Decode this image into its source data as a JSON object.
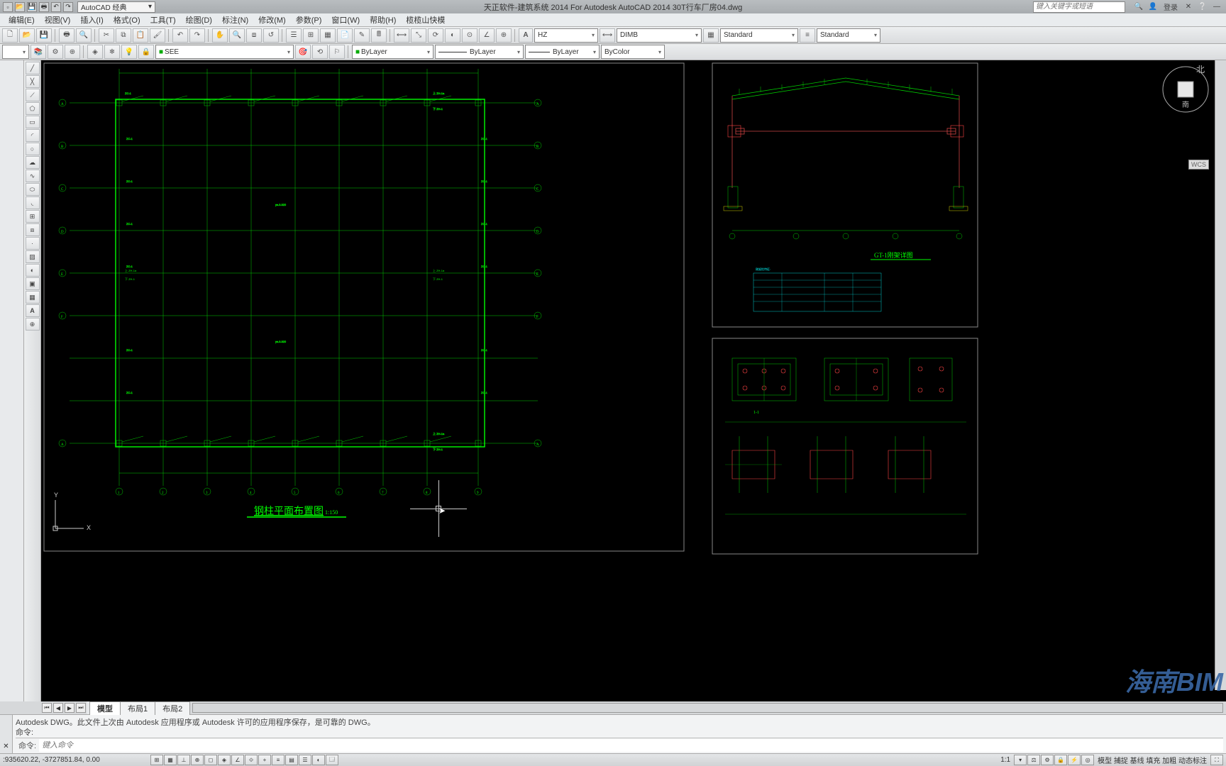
{
  "titlebar": {
    "workspace": "AutoCAD 经典",
    "title": "天正软件-建筑系统 2014  For Autodesk AutoCAD 2014    30T行车厂房04.dwg",
    "search_placeholder": "键入关键字或短语",
    "login": "登录"
  },
  "menus": [
    "编辑(E)",
    "视图(V)",
    "插入(I)",
    "格式(O)",
    "工具(T)",
    "绘图(D)",
    "标注(N)",
    "修改(M)",
    "参数(P)",
    "窗口(W)",
    "帮助(H)",
    "榄榄山快模"
  ],
  "toolbar1": {
    "text_style": "HZ",
    "dim_style": "DIMB",
    "table_style": "Standard",
    "ml_style": "Standard"
  },
  "toolbar2": {
    "layer": "SEE",
    "layer_color": "ByLayer",
    "linetype": "ByLayer",
    "lineweight": "ByLayer",
    "plot_style": "ByColor"
  },
  "layout_tabs": {
    "tabs": [
      "模型",
      "布局1",
      "布局2"
    ],
    "active": 0
  },
  "command": {
    "history1": "Autodesk DWG。此文件上次由 Autodesk 应用程序或 Autodesk 许可的应用程序保存，是可靠的 DWG。",
    "history2": "命令:",
    "prompt": "命令:",
    "placeholder": "键入命令"
  },
  "statusbar": {
    "coords": ":935620.22, -3727851.84, 0.00",
    "scale": "1:1",
    "right_text": "模型 捕捉 基线 填充 加粗 动态标注"
  },
  "drawing": {
    "plan_title": "钢柱平面布置图",
    "plan_scale": "1:150",
    "section_title": "GT-1刚架详图",
    "row_labels": [
      "A",
      "B",
      "C",
      "D",
      "E",
      "F",
      "A"
    ],
    "col_labels": [
      "1",
      "2",
      "3",
      "4",
      "5",
      "6",
      "7",
      "8",
      "9"
    ],
    "beam_labels": {
      "top": "上 ZH-1a",
      "bottom": "下 ZH-1",
      "brace": "ZC-1",
      "brace2": "ZC-2",
      "ys": "ys.3.320"
    },
    "wcs": "WCS"
  },
  "viewcube": {
    "north": "北",
    "south": "南"
  },
  "watermark": "海南BIM"
}
